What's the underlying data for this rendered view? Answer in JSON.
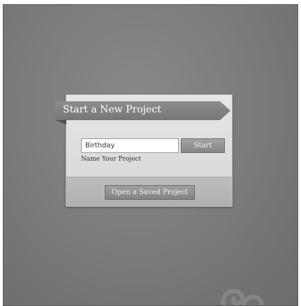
{
  "dialog": {
    "title": "Start a New Project",
    "project_name": {
      "value": "Birthday",
      "label": "Name Your Project"
    },
    "start_label": "Start",
    "open_saved_label": "Open a Saved Project"
  },
  "decor": {
    "watermark_icon": "swirl-logo-icon"
  },
  "colors": {
    "background": "#7a7a7a",
    "dialog": "#dcdcdc",
    "banner": "#828282",
    "button": "#939393"
  }
}
